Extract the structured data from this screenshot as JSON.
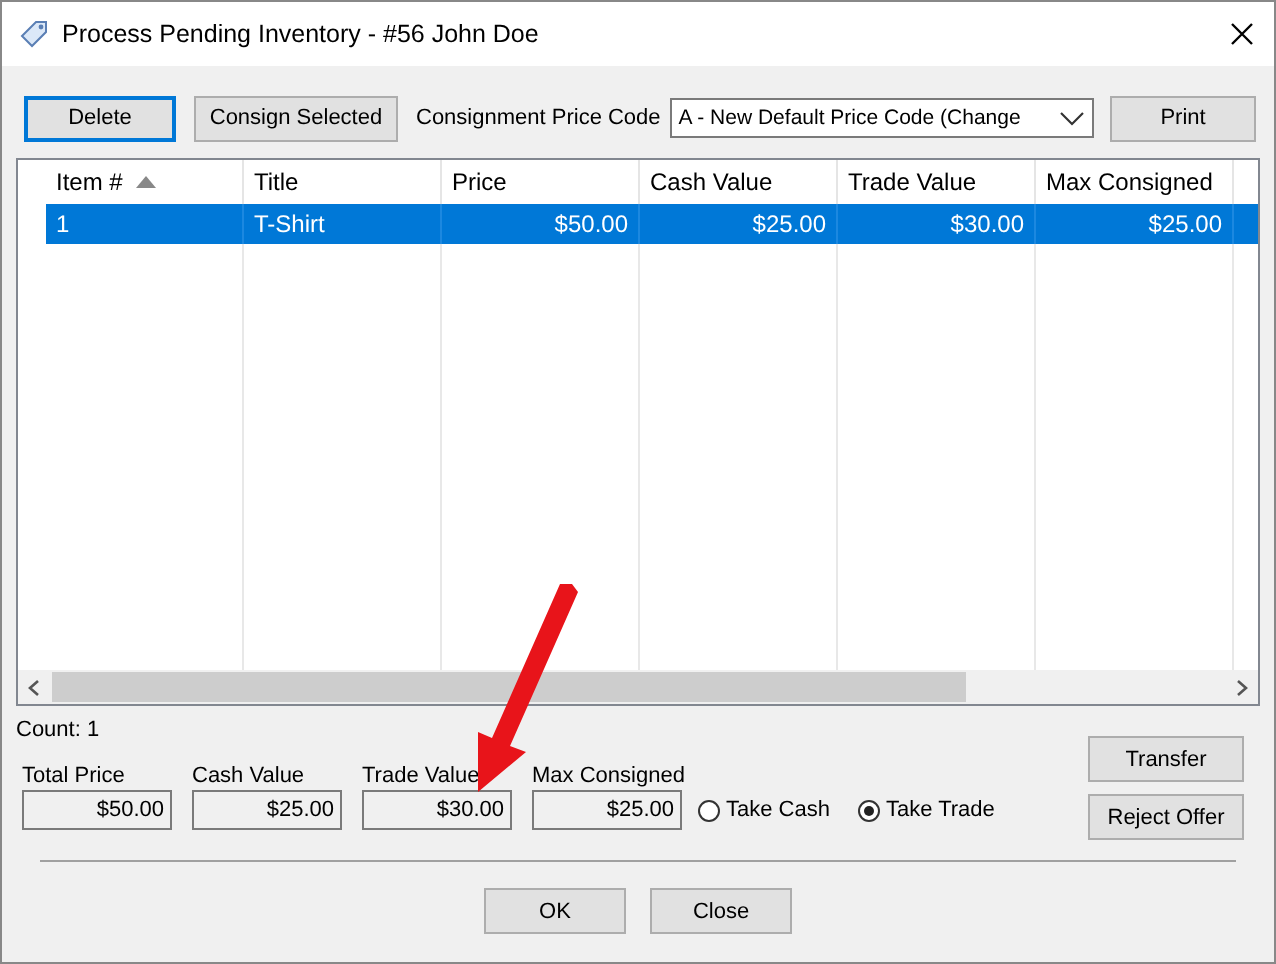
{
  "window": {
    "title": "Process Pending Inventory - #56 John Doe"
  },
  "toolbar": {
    "buttons": [
      {
        "label": "Delete",
        "focused": true
      },
      {
        "label": "Consign Selected",
        "focused": false
      }
    ],
    "price_code_label": "Consignment Price Code",
    "price_code_value": "A - New Default Price Code (Change",
    "print_button": "Print"
  },
  "table": {
    "columns": [
      {
        "label": "Item #",
        "sorted": true
      },
      {
        "label": "Title",
        "sorted": false
      },
      {
        "label": "Price",
        "sorted": false
      },
      {
        "label": "Cash Value",
        "sorted": false
      },
      {
        "label": "Trade Value",
        "sorted": false
      },
      {
        "label": "Max Consigned",
        "sorted": false
      }
    ],
    "rows": [
      {
        "selected": true,
        "cells": [
          "1",
          "T-Shirt",
          "$50.00",
          "$25.00",
          "$30.00",
          "$25.00"
        ]
      }
    ]
  },
  "count": "Count: 1",
  "totals": [
    {
      "label": "Total Price",
      "value": "$50.00"
    },
    {
      "label": "Cash Value",
      "value": "$25.00"
    },
    {
      "label": "Trade Value",
      "value": "$30.00"
    },
    {
      "label": "Max Consigned",
      "value": "$25.00"
    }
  ],
  "options": [
    {
      "label": "Take Cash",
      "selected": false
    },
    {
      "label": "Take Trade",
      "selected": true
    }
  ],
  "side_buttons": [
    "Transfer",
    "Reject Offer"
  ],
  "footer_buttons": [
    "OK",
    "Close"
  ]
}
